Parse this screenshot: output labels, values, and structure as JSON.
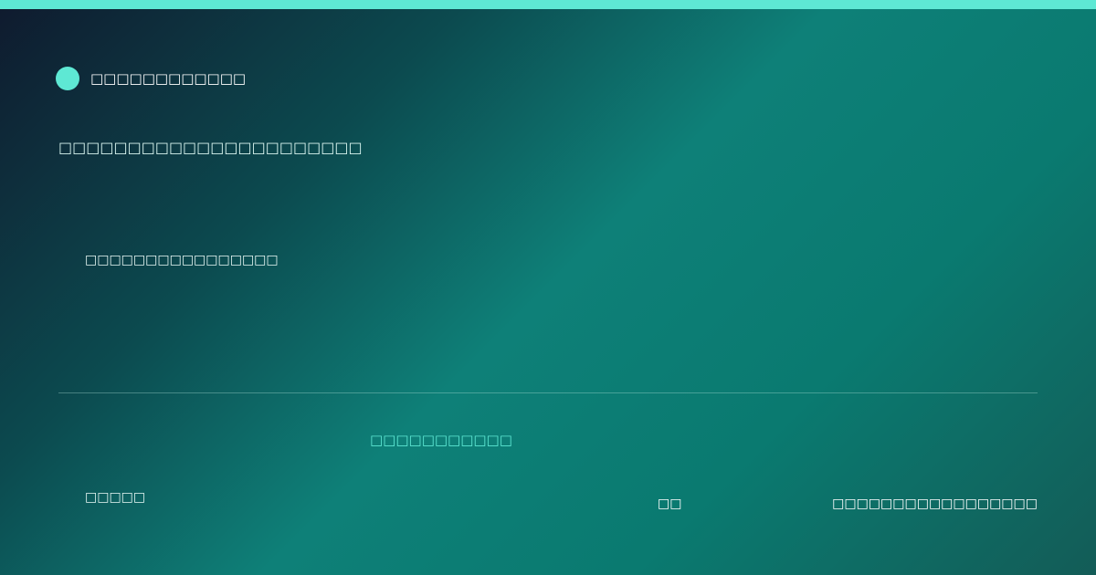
{
  "colors": {
    "accent": "#5ee8d4",
    "background_start": "#0f1a2e",
    "background_mid": "#0e8078",
    "background_end": "#135c57"
  },
  "brand": {
    "name": "□□□□□□□□□□□□"
  },
  "headline": "□□□□□□□□□□□□□□□□□□□□□□",
  "subtitle": "□□□□□□□□□□□□□□□□",
  "link_text": "□□□□□□□□□□□",
  "footer": {
    "left": "□□□□□",
    "middle": "□□",
    "right": "□□□□□□□□□□□□□□□□□"
  }
}
